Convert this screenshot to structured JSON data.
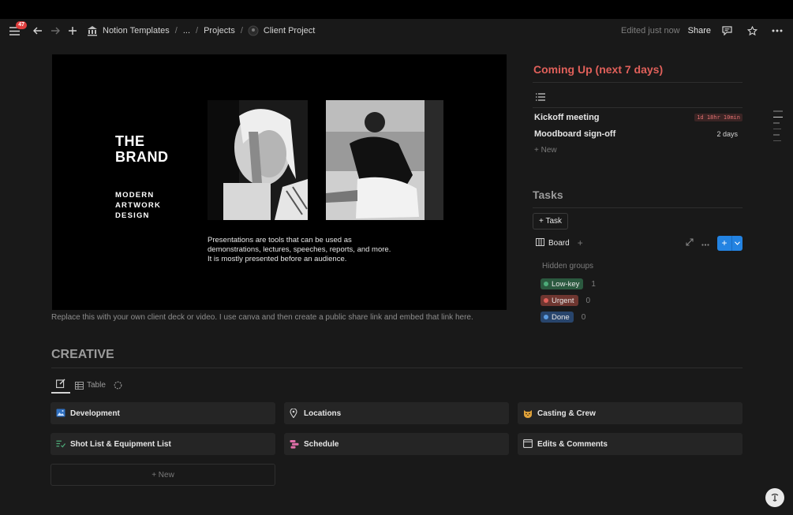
{
  "topbar": {
    "notification_count": "47",
    "breadcrumbs": {
      "workspace": "Notion Templates",
      "ellipsis": "...",
      "parent": "Projects",
      "current": "Client Project"
    },
    "edited": "Edited just now",
    "share": "Share"
  },
  "slide": {
    "title_line1": "THE",
    "title_line2": "BRAND",
    "sub_line1": "MODERN",
    "sub_line2": "ARTWORK",
    "sub_line3": "DESIGN",
    "body": "Presentations are tools that can be used as demonstrations, lectures, speeches, reports, and more. It is mostly presented before an audience."
  },
  "caption": "Replace this with your own client deck or video. I use canva and then create a public share link and embed that link here.",
  "coming_up": {
    "title": "Coming Up (next 7 days)",
    "events": [
      {
        "name": "Kickoff meeting",
        "due": "1d 18hr 10min"
      },
      {
        "name": "Moodboard sign-off",
        "due": "2 days"
      }
    ],
    "new_label": "New"
  },
  "tasks": {
    "title": "Tasks",
    "task_button": "+ Task",
    "view_label": "Board",
    "hidden_groups_label": "Hidden groups",
    "groups": [
      {
        "label": "Low-key",
        "count": "1",
        "bg": "#2b593f",
        "dot": "#4dab79"
      },
      {
        "label": "Urgent",
        "count": "0",
        "bg": "#6e3630",
        "dot": "#e0605a"
      },
      {
        "label": "Done",
        "count": "0",
        "bg": "#28456c",
        "dot": "#5b9be0"
      }
    ]
  },
  "creative": {
    "title": "CREATIVE",
    "tab_table": "Table",
    "cards": [
      {
        "label": "Development"
      },
      {
        "label": "Locations"
      },
      {
        "label": "Casting & Crew"
      },
      {
        "label": "Shot List & Equipment List"
      },
      {
        "label": "Schedule"
      },
      {
        "label": "Edits & Comments"
      }
    ],
    "new_label": "+ New"
  },
  "colors": {
    "accent_blue": "#2383e2",
    "heading_red": "#e0605a",
    "background": "#191919"
  }
}
